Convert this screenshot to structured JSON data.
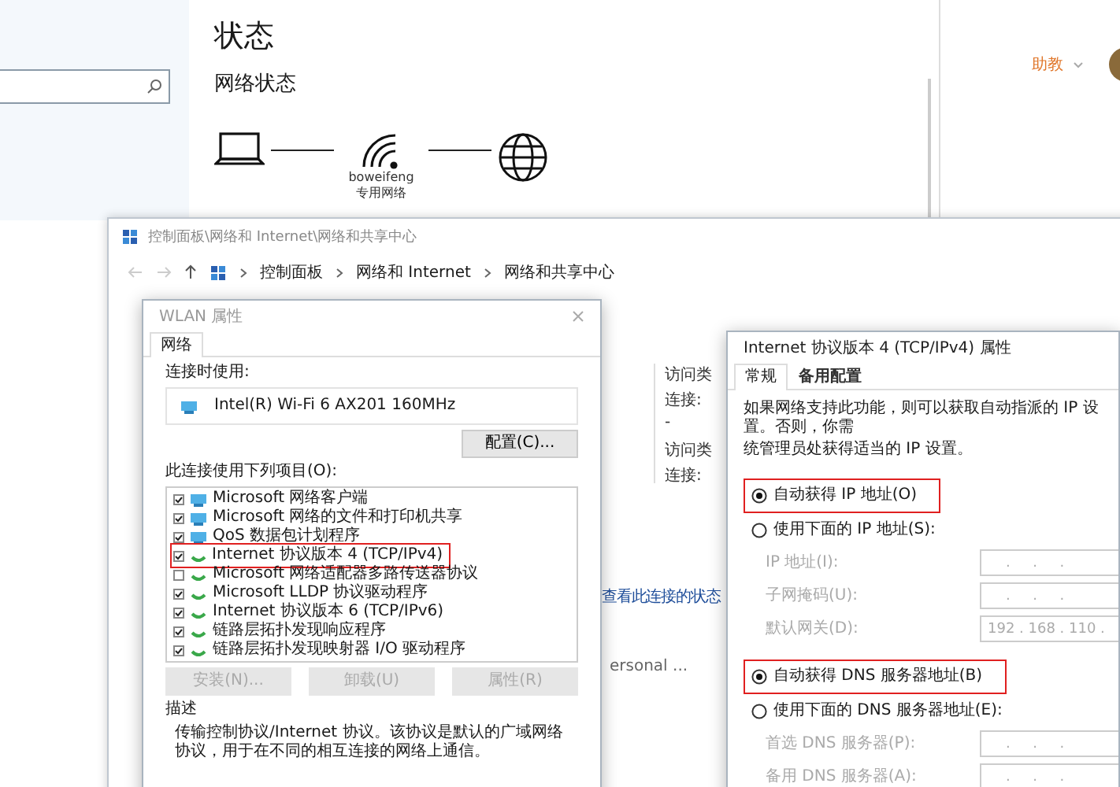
{
  "settings_window": {
    "title": "状态",
    "section": "网络状态",
    "network": {
      "name": "boweifeng",
      "profile": "专用网络"
    }
  },
  "account": {
    "name": "助教"
  },
  "control_panel": {
    "title": "控制面板\\网络和 Internet\\网络和共享中心",
    "breadcrumb": [
      "控制面板",
      "网络和 Internet",
      "网络和共享中心"
    ],
    "info_labels": [
      "访问类",
      "连接:",
      "-",
      "访问类",
      "连接:"
    ],
    "status_link": "查看此连接的状态",
    "connection_name": "ersonal ..."
  },
  "wlan_dialog": {
    "title": "WLAN 属性",
    "tabs": [
      {
        "label": "网络",
        "selected": true
      }
    ],
    "connect_using_label": "连接时使用:",
    "adapter": "Intel(R) Wi-Fi 6 AX201 160MHz",
    "configure_button": "配置(C)...",
    "items_label": "此连接使用下列项目(O):",
    "items": [
      {
        "label": "Microsoft 网络客户端",
        "checked": true,
        "highlighted": false,
        "kind": "service"
      },
      {
        "label": "Microsoft 网络的文件和打印机共享",
        "checked": true,
        "highlighted": false,
        "kind": "service"
      },
      {
        "label": "QoS 数据包计划程序",
        "checked": true,
        "highlighted": false,
        "kind": "service"
      },
      {
        "label": "Internet 协议版本 4 (TCP/IPv4)",
        "checked": true,
        "highlighted": true,
        "kind": "protocol"
      },
      {
        "label": "Microsoft 网络适配器多路传送器协议",
        "checked": false,
        "highlighted": false,
        "kind": "protocol"
      },
      {
        "label": "Microsoft LLDP 协议驱动程序",
        "checked": true,
        "highlighted": false,
        "kind": "protocol"
      },
      {
        "label": "Internet 协议版本 6 (TCP/IPv6)",
        "checked": true,
        "highlighted": false,
        "kind": "protocol"
      },
      {
        "label": "链路层拓扑发现响应程序",
        "checked": true,
        "highlighted": false,
        "kind": "protocol"
      },
      {
        "label": "链路层拓扑发现映射器 I/O 驱动程序",
        "checked": true,
        "highlighted": false,
        "kind": "protocol"
      }
    ],
    "buttons": [
      {
        "label": "安装(N)...",
        "disabled": true
      },
      {
        "label": "卸载(U)",
        "disabled": true
      },
      {
        "label": "属性(R)",
        "disabled": true
      }
    ],
    "description_label": "描述",
    "description": "传输控制协议/Internet 协议。该协议是默认的广域网络协议，用于在不同的相互连接的网络上通信。"
  },
  "ipv4_dialog": {
    "title": "Internet 协议版本 4 (TCP/IPv4) 属性",
    "tabs": [
      {
        "label": "常规",
        "selected": true
      },
      {
        "label": "备用配置",
        "selected": false
      }
    ],
    "intro": [
      "如果网络支持此功能，则可以获取自动指派的 IP 设置。否则，你需",
      "统管理员处获得适当的 IP 设置。"
    ],
    "ip_mode": [
      {
        "label": "自动获得 IP 地址(O)",
        "selected": true,
        "highlighted": true
      },
      {
        "label": "使用下面的 IP 地址(S):",
        "selected": false,
        "highlighted": false
      }
    ],
    "ip_fields": [
      {
        "label": "IP 地址(I):",
        "value": "    .     .     .",
        "disabled": true
      },
      {
        "label": "子网掩码(U):",
        "value": "    .     .     .",
        "disabled": true
      },
      {
        "label": "默认网关(D):",
        "value": "192 . 168 . 110 .",
        "disabled": true
      }
    ],
    "dns_mode": [
      {
        "label": "自动获得 DNS 服务器地址(B)",
        "selected": true,
        "highlighted": true
      },
      {
        "label": "使用下面的 DNS 服务器地址(E):",
        "selected": false,
        "highlighted": false
      }
    ],
    "dns_fields": [
      {
        "label": "首选 DNS 服务器(P):",
        "value": "    .     .     .",
        "disabled": true
      },
      {
        "label": "备用 DNS 服务器(A):",
        "value": "    .     .     .",
        "disabled": true
      }
    ]
  }
}
